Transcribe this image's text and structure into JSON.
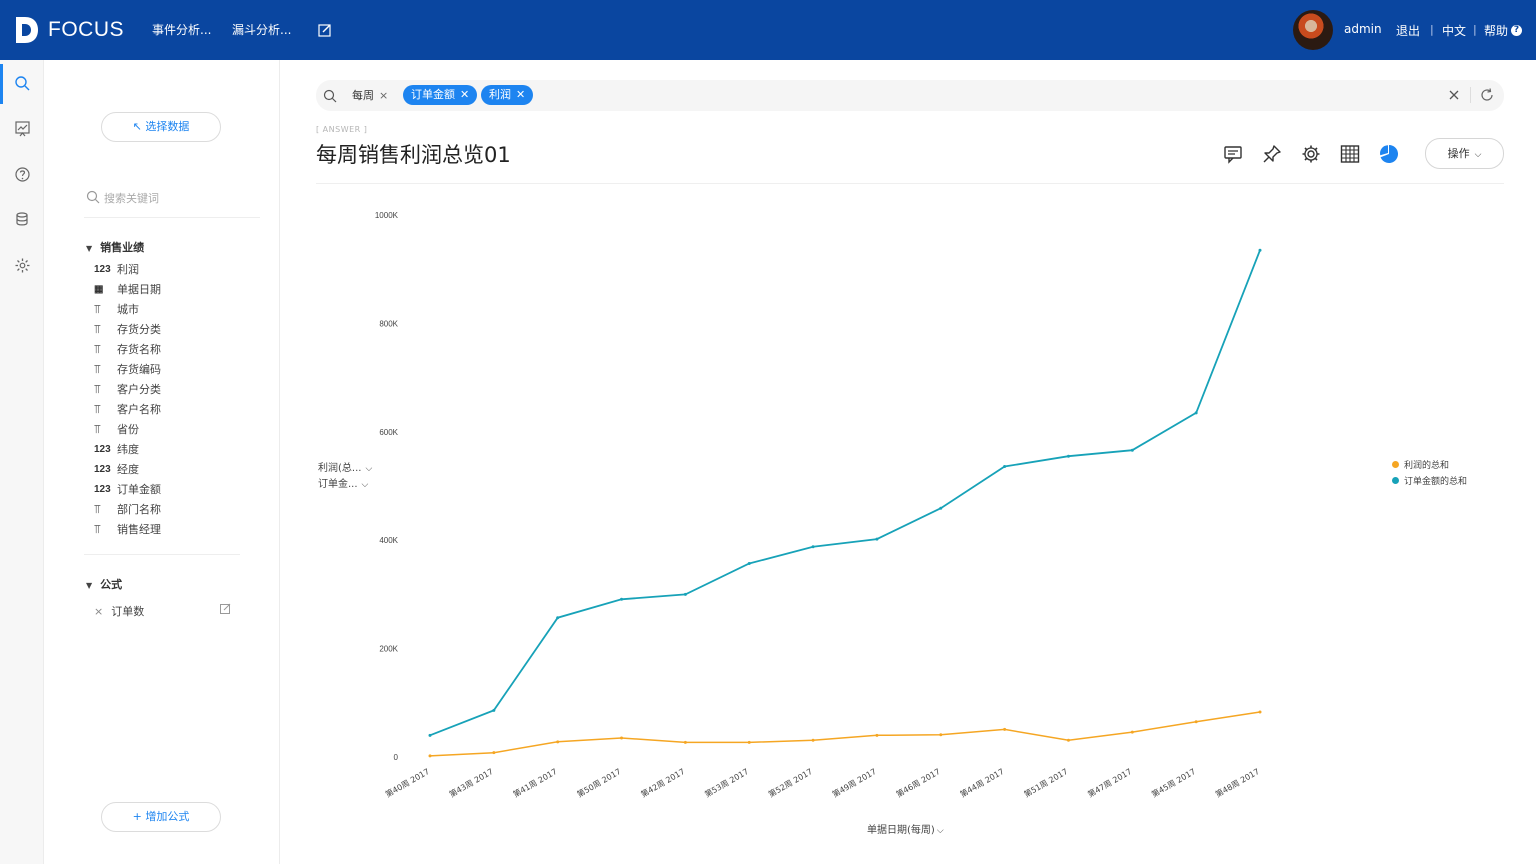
{
  "app": {
    "logo_text": "FOCUS"
  },
  "nav": {
    "items": [
      "事件分析...",
      "漏斗分析..."
    ],
    "user": "admin",
    "logout": "退出",
    "lang": "中文",
    "help": "帮助",
    "help_mark": "?"
  },
  "panel": {
    "select_data": "↖ 选择数据",
    "search_placeholder": "搜索关键词",
    "group1_title": "销售业绩",
    "fields": [
      {
        "type": "123",
        "name": "利润"
      },
      {
        "type": "date",
        "name": "单据日期"
      },
      {
        "type": "text",
        "name": "城市"
      },
      {
        "type": "text",
        "name": "存货分类"
      },
      {
        "type": "text",
        "name": "存货名称"
      },
      {
        "type": "text",
        "name": "存货编码"
      },
      {
        "type": "text",
        "name": "客户分类"
      },
      {
        "type": "text",
        "name": "客户名称"
      },
      {
        "type": "text",
        "name": "省份"
      },
      {
        "type": "123",
        "name": "纬度"
      },
      {
        "type": "123",
        "name": "经度"
      },
      {
        "type": "123",
        "name": "订单金额"
      },
      {
        "type": "text",
        "name": "部门名称"
      },
      {
        "type": "text",
        "name": "销售经理"
      }
    ],
    "group2_title": "公式",
    "formula_item": "订单数",
    "add_formula": "+ 增加公式"
  },
  "search": {
    "plain_token": "每周",
    "tokens": [
      "订单金额",
      "利润"
    ]
  },
  "answer": {
    "label": "[ ANSWER ]",
    "title": "每周销售利润总览01",
    "operate": "操作"
  },
  "chart_data": {
    "type": "line",
    "categories": [
      "第40周 2017",
      "第43周 2017",
      "第41周 2017",
      "第50周 2017",
      "第42周 2017",
      "第53周 2017",
      "第52周 2017",
      "第49周 2017",
      "第46周 2017",
      "第44周 2017",
      "第51周 2017",
      "第47周 2017",
      "第45周 2017",
      "第48周 2017"
    ],
    "series": [
      {
        "name": "利润的总和",
        "color": "#f5a623",
        "values": [
          2000,
          8000,
          28000,
          35000,
          27000,
          27000,
          31000,
          40000,
          41000,
          51000,
          31000,
          46000,
          65000,
          83000
        ]
      },
      {
        "name": "订单金额的总和",
        "color": "#17a2b8",
        "values": [
          40000,
          86000,
          257000,
          291000,
          300000,
          357000,
          388000,
          402000,
          459000,
          536000,
          555000,
          566000,
          635000,
          935000
        ]
      }
    ],
    "yticks": [
      "1000K",
      "800K",
      "600K",
      "400K",
      "200K",
      "0"
    ],
    "ylim": [
      0,
      1000000
    ],
    "y_selectors": [
      "利润(总...",
      "订单金..."
    ],
    "xlabel": "单据日期(每周)",
    "legend_position": "right"
  }
}
